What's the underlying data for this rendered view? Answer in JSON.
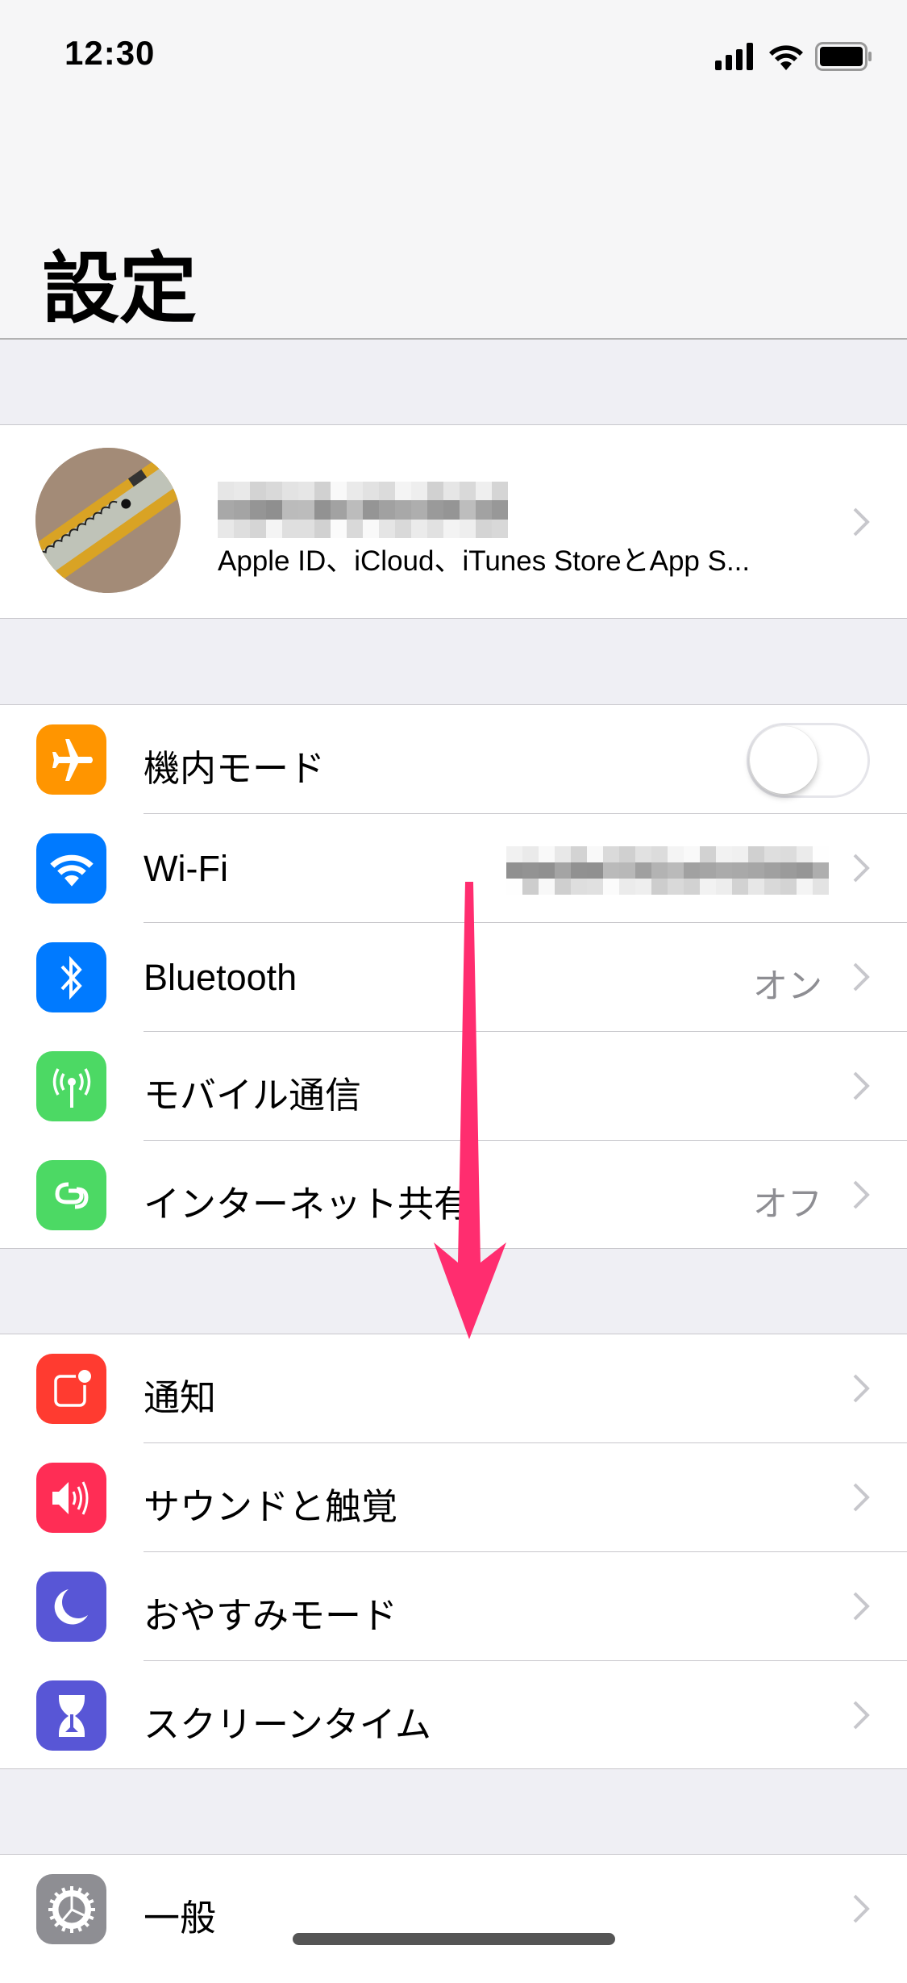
{
  "status_bar": {
    "time": "12:30",
    "icons": [
      "cellular-signal-icon",
      "wifi-icon",
      "battery-icon"
    ]
  },
  "nav": {
    "title": "設定"
  },
  "profile": {
    "name": "(blurred)",
    "subtitle": "Apple ID、iCloud、iTunes StoreとApp S..."
  },
  "sections": [
    {
      "rows": [
        {
          "label": "機内モード",
          "icon": "airplane-icon",
          "color": "#ff9500",
          "toggle": false
        },
        {
          "label": "Wi-Fi",
          "icon": "wifi-icon",
          "color": "#007aff",
          "value": "(blurred)"
        },
        {
          "label": "Bluetooth",
          "icon": "bluetooth-icon",
          "color": "#007aff",
          "value": "オン"
        },
        {
          "label": "モバイル通信",
          "icon": "antenna-icon",
          "color": "#4cd964"
        },
        {
          "label": "インターネット共有",
          "icon": "hotspot-icon",
          "color": "#4cd964",
          "value": "オフ"
        }
      ]
    },
    {
      "rows": [
        {
          "label": "通知",
          "icon": "notifications-icon",
          "color": "#ff3b30"
        },
        {
          "label": "サウンドと触覚",
          "icon": "speaker-icon",
          "color": "#ff2d55"
        },
        {
          "label": "おやすみモード",
          "icon": "moon-icon",
          "color": "#5856d6"
        },
        {
          "label": "スクリーンタイム",
          "icon": "hourglass-icon",
          "color": "#5856d6"
        }
      ]
    },
    {
      "rows": [
        {
          "label": "一般",
          "icon": "gear-icon",
          "color": "#8e8e93"
        }
      ]
    }
  ],
  "annotation": {
    "type": "scroll-down-arrow",
    "color": "#ff2d6f"
  }
}
